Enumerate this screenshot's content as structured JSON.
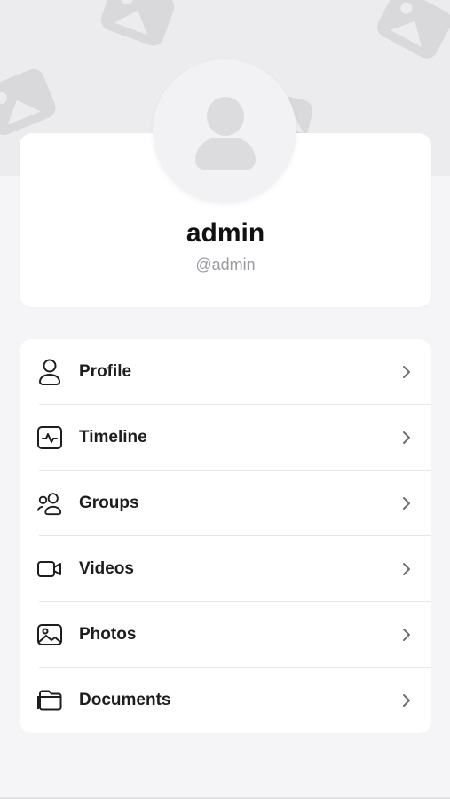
{
  "profile": {
    "name": "admin",
    "username": "@admin"
  },
  "menu": {
    "items": [
      {
        "label": "Profile",
        "icon": "person-icon"
      },
      {
        "label": "Timeline",
        "icon": "activity-icon"
      },
      {
        "label": "Groups",
        "icon": "group-icon"
      },
      {
        "label": "Videos",
        "icon": "video-camera-icon"
      },
      {
        "label": "Photos",
        "icon": "photo-icon"
      },
      {
        "label": "Documents",
        "icon": "folder-icon"
      }
    ]
  },
  "colors": {
    "background": "#f5f5f7",
    "card": "#ffffff",
    "cover": "#ececee",
    "text": "#1d1d1f",
    "muted": "#9a9aa0"
  }
}
